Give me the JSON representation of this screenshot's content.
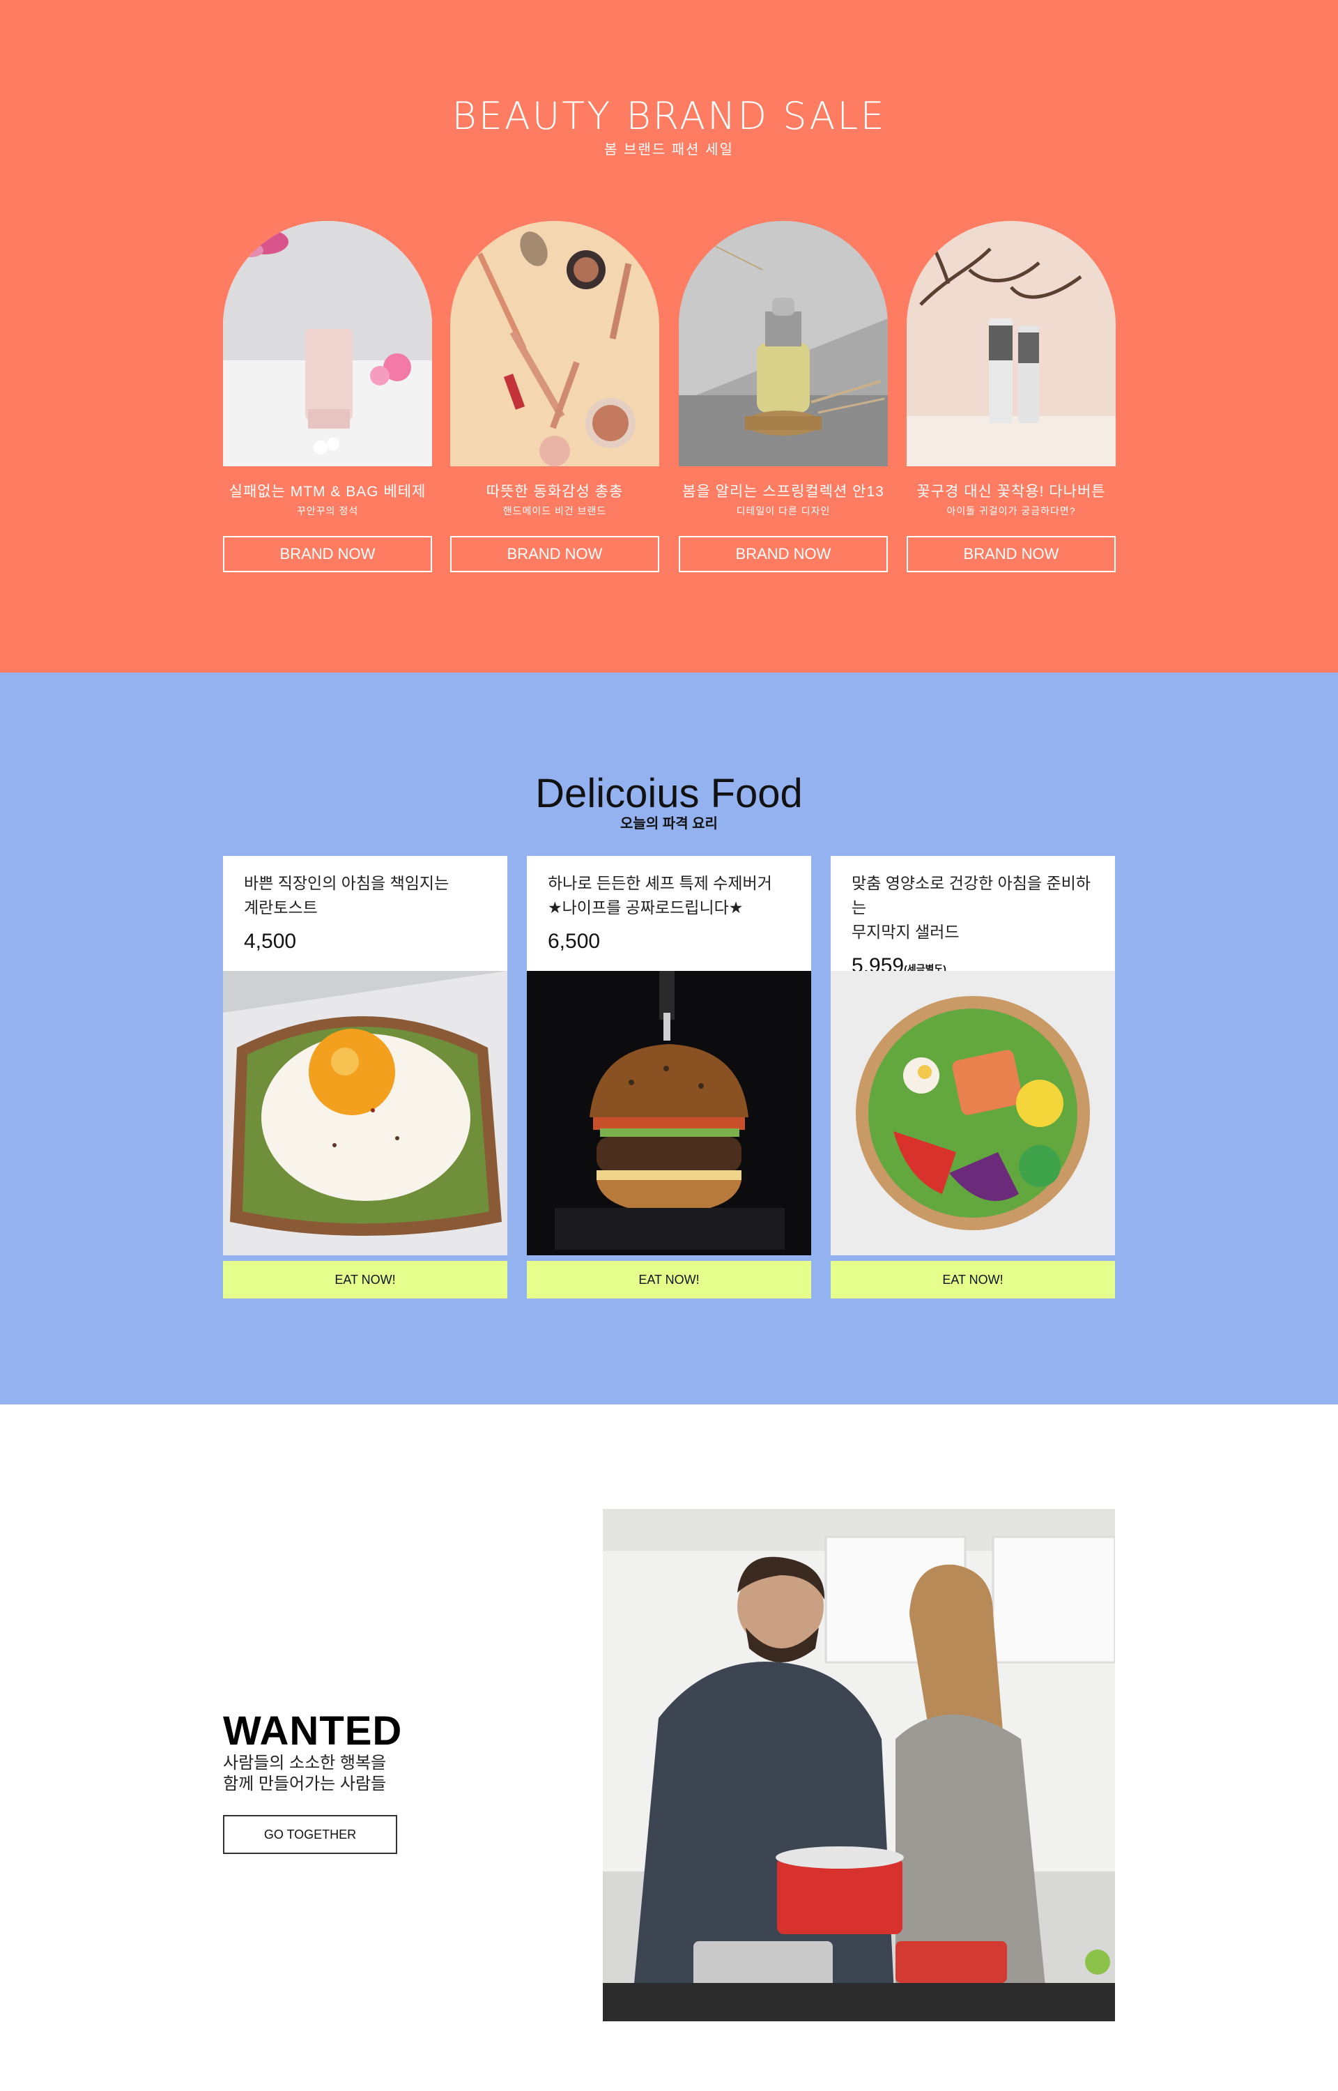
{
  "beauty": {
    "title": "BEAUTY BRAND SALE",
    "subtitle": "봄 브랜드 패션 세일",
    "cards": [
      {
        "title": "실패없는 MTM & BAG 베테제",
        "subtitle": "꾸안꾸의 정석",
        "button": "BRAND NOW"
      },
      {
        "title": "따뜻한 동화감성 총총",
        "subtitle": "핸드메이드 비건 브랜드",
        "button": "BRAND NOW"
      },
      {
        "title": "봄을 알리는 스프링컬렉션 안13",
        "subtitle": "디테일이 다른 디자인",
        "button": "BRAND NOW"
      },
      {
        "title": "꽃구경 대신 꽃착용! 다나버튼",
        "subtitle": "아이돌 귀걸이가 궁금하다면?",
        "button": "BRAND NOW"
      }
    ]
  },
  "food": {
    "title": "Delicoius Food",
    "subtitle": "오늘의 파격 요리",
    "cards": [
      {
        "desc_line1": "바쁜 직장인의 아침을 책임지는",
        "desc_line2": "계란토스트",
        "price": "4,500",
        "price_note": "",
        "button": "EAT NOW!"
      },
      {
        "desc_line1": "하나로 든든한 셰프 특제 수제버거",
        "desc_line2": "★나이프를 공짜로드립니다★",
        "price": "6,500",
        "price_note": "",
        "button": "EAT NOW!"
      },
      {
        "desc_line1": "맞춤 영양소로 건강한 아침을 준비하는",
        "desc_line2": "무지막지 샐러드",
        "price": "5,959",
        "price_note": "(세금별도)",
        "button": "EAT NOW!"
      }
    ]
  },
  "wanted": {
    "title": "WANTED",
    "subtitle_line1": "사람들의 소소한 행복을",
    "subtitle_line2": "함께 만들어가는 사람들",
    "button": "GO TOGETHER"
  },
  "colors": {
    "beauty_bg": "#fe7c62",
    "food_bg": "#94b2f0",
    "eat_button": "#e6ff8c"
  }
}
